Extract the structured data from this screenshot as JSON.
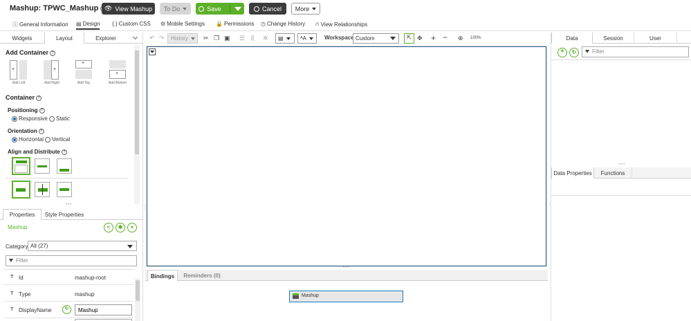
{
  "header": {
    "title": "Mashup: TPWC_Mashup",
    "help": "?",
    "view_label": "View Mashup",
    "todo_label": "To Do",
    "save_label": "Save",
    "cancel_label": "Cancel",
    "more_label": "More"
  },
  "tabs": [
    {
      "label": "General Information",
      "icon": "info-icon"
    },
    {
      "label": "Design",
      "icon": "design-icon"
    },
    {
      "label": "Custom CSS",
      "icon": "css-icon"
    },
    {
      "label": "Mobile Settings",
      "icon": "gear-icon"
    },
    {
      "label": "Permissions",
      "icon": "lock-icon"
    },
    {
      "label": "Change History",
      "icon": "clock-icon"
    },
    {
      "label": "View Relationships",
      "icon": "relationships-icon"
    }
  ],
  "left_tabs": [
    "Widgets",
    "Layout",
    "Explorer"
  ],
  "layout": {
    "add_container": "Add Container",
    "tiles": [
      "Add Left",
      "Add Right",
      "Add Top",
      "Add Bottom"
    ],
    "container": "Container",
    "positioning": "Positioning",
    "pos_options": [
      "Responsive",
      "Static"
    ],
    "orientation": "Orientation",
    "orient_options": [
      "Horizontal",
      "Vertical"
    ],
    "align": "Align and Distribute"
  },
  "properties": {
    "tabs": [
      "Properties",
      "Style Properties"
    ],
    "entity": "Mashup",
    "category_label": "Category",
    "category_value": "All (27)",
    "filter_placeholder": "Filter",
    "rows": [
      {
        "type": "T",
        "name": "Id",
        "value": "mashup-root"
      },
      {
        "type": "T",
        "name": "Type",
        "value": "mashup"
      },
      {
        "type": "T",
        "name": "DisplayName",
        "value": "Mashup"
      }
    ]
  },
  "toolbar": {
    "history": "History",
    "workspace_label": "Workspace",
    "workspace_value": "Custom",
    "zoom": "100%"
  },
  "bindings": {
    "tabs": [
      "Bindings",
      "Reminders (0)"
    ],
    "node": "Mashup"
  },
  "right": {
    "tabs": [
      "Data",
      "Session",
      "User"
    ],
    "filter_placeholder": "Filter",
    "bottom_tabs": [
      "Data Properties",
      "Functions"
    ]
  },
  "colors": {
    "accent_green": "#5cb029",
    "dark_button": "#3b3b3b",
    "canvas_border": "#1d4f79",
    "selection_blue": "#1a7bc2"
  }
}
